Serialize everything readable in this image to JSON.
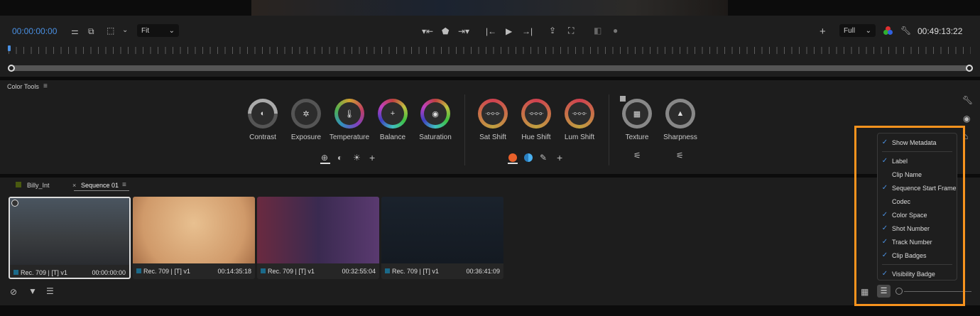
{
  "monitor": {
    "current_timecode": "00:00:00:00",
    "zoom_select": "Fit",
    "resolution_select": "Full",
    "duration_timecode": "00:49:13:22"
  },
  "color_tools": {
    "title": "Color Tools",
    "group1": [
      {
        "label": "Contrast",
        "glyph": "◐"
      },
      {
        "label": "Exposure",
        "glyph": "✲"
      },
      {
        "label": "Temperature",
        "glyph": "🌡"
      },
      {
        "label": "Balance",
        "glyph": "+"
      },
      {
        "label": "Saturation",
        "glyph": "◉"
      }
    ],
    "group2": [
      {
        "label": "Sat Shift",
        "glyph": "-o-o-o-"
      },
      {
        "label": "Hue Shift",
        "glyph": "-o-o-o-"
      },
      {
        "label": "Lum Shift",
        "glyph": "-o-o-o-"
      }
    ],
    "group3": [
      {
        "label": "Texture",
        "glyph": "▦"
      },
      {
        "label": "Sharpness",
        "glyph": "▲"
      }
    ]
  },
  "bin": {
    "tabs": [
      {
        "label": "Billy_Int"
      },
      {
        "label": "Sequence 01"
      }
    ],
    "clips": [
      {
        "meta": "Rec. 709 | [T] v1",
        "timecode": "00:00:00:00"
      },
      {
        "meta": "Rec. 709 | [T] v1",
        "timecode": "00:14:35:18"
      },
      {
        "meta": "Rec. 709 | [T] v1",
        "timecode": "00:32:55:04"
      },
      {
        "meta": "Rec. 709 | [T] v1",
        "timecode": "00:36:41:09"
      }
    ]
  },
  "metadata_menu": {
    "items": [
      {
        "label": "Show Metadata",
        "checked": true
      },
      {
        "label": "Label",
        "checked": true
      },
      {
        "label": "Clip Name",
        "checked": false
      },
      {
        "label": "Sequence Start Frame",
        "checked": true
      },
      {
        "label": "Codec",
        "checked": false
      },
      {
        "label": "Color Space",
        "checked": true
      },
      {
        "label": "Shot Number",
        "checked": true
      },
      {
        "label": "Track Number",
        "checked": true
      },
      {
        "label": "Clip Badges",
        "checked": true
      },
      {
        "label": "Visibility Badge",
        "checked": true
      }
    ]
  },
  "check_glyph": "✓",
  "colors": {
    "accent": "#4a90e2",
    "highlight": "#f7931e"
  }
}
